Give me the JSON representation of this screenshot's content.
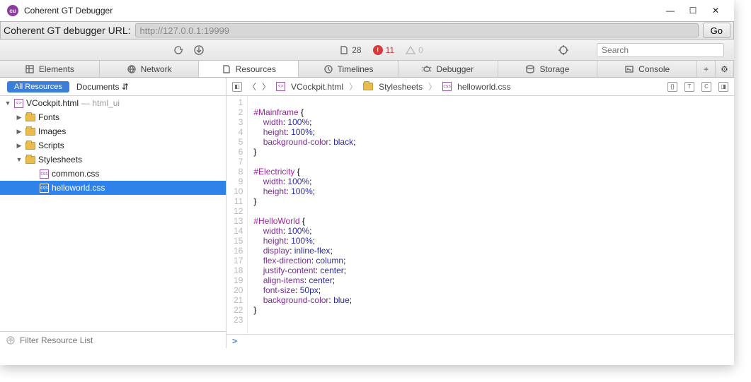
{
  "window": {
    "title": "Coherent GT Debugger"
  },
  "address": {
    "label": "Coherent GT debugger URL:",
    "value": "http://127.0.0.1:19999",
    "go": "Go"
  },
  "toolbar": {
    "doc_count": "28",
    "error_count": "11",
    "warn_count": "0",
    "search_placeholder": "Search"
  },
  "tabs": {
    "elements": "Elements",
    "network": "Network",
    "resources": "Resources",
    "timelines": "Timelines",
    "debugger": "Debugger",
    "storage": "Storage",
    "console": "Console"
  },
  "subbar": {
    "all_resources": "All Resources",
    "documents": "Documents"
  },
  "breadcrumb": {
    "root": "VCockpit.html",
    "folder": "Stylesheets",
    "file": "helloworld.css"
  },
  "tree": {
    "root_file": "VCockpit.html",
    "root_suffix": " — html_ui",
    "folders": {
      "fonts": "Fonts",
      "images": "Images",
      "scripts": "Scripts",
      "stylesheets": "Stylesheets"
    },
    "files": {
      "common": "common.css",
      "helloworld": "helloworld.css"
    },
    "filter_placeholder": "Filter Resource List"
  },
  "code": {
    "lines": [
      "",
      "#Mainframe {",
      "    width: 100%;",
      "    height: 100%;",
      "    background-color: black;",
      "}",
      "",
      "#Electricity {",
      "    width: 100%;",
      "    height: 100%;",
      "}",
      "",
      "#HelloWorld {",
      "    width: 100%;",
      "    height: 100%;",
      "    display: inline-flex;",
      "    flex-direction: column;",
      "    justify-content: center;",
      "    align-items: center;",
      "    font-size: 50px;",
      "    background-color: blue;",
      "}",
      ""
    ]
  },
  "prompt": ">"
}
